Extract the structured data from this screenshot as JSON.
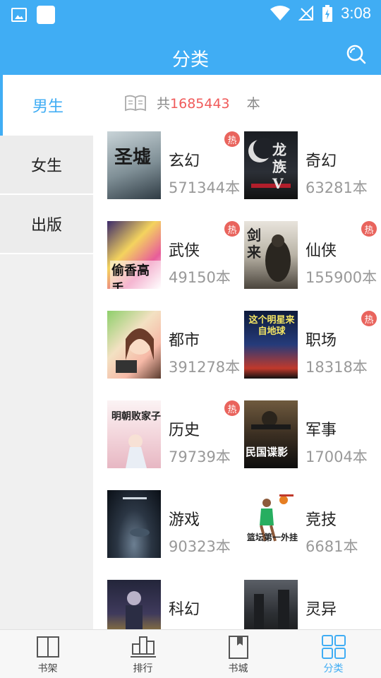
{
  "status_bar": {
    "time": "3:08"
  },
  "header": {
    "title": "分类"
  },
  "sidebar": {
    "items": [
      {
        "label": "男生",
        "active": true
      },
      {
        "label": "女生",
        "active": false
      },
      {
        "label": "出版",
        "active": false
      }
    ]
  },
  "summary": {
    "prefix": "共",
    "count": "1685443",
    "suffix": "本"
  },
  "categories": [
    {
      "name": "玄幻",
      "count": "571344本",
      "hot": "热",
      "cover_text": "圣墟"
    },
    {
      "name": "奇幻",
      "count": "63281本",
      "hot": "",
      "cover_text": "龙族V"
    },
    {
      "name": "武侠",
      "count": "49150本",
      "hot": "热",
      "cover_text": "偷香高手"
    },
    {
      "name": "仙侠",
      "count": "155900本",
      "hot": "热",
      "cover_text": "剑来"
    },
    {
      "name": "都市",
      "count": "391278本",
      "hot": "",
      "cover_text": ""
    },
    {
      "name": "职场",
      "count": "18318本",
      "hot": "热",
      "cover_text": "这个明星来自地球"
    },
    {
      "name": "历史",
      "count": "79739本",
      "hot": "热",
      "cover_text": "明朝败家子"
    },
    {
      "name": "军事",
      "count": "17004本",
      "hot": "",
      "cover_text": "民国谍影"
    },
    {
      "name": "游戏",
      "count": "90323本",
      "hot": "",
      "cover_text": ""
    },
    {
      "name": "竞技",
      "count": "6681本",
      "hot": "",
      "cover_text": "篮坛第一外挂"
    },
    {
      "name": "科幻",
      "count": "",
      "hot": "",
      "cover_text": ""
    },
    {
      "name": "灵异",
      "count": "",
      "hot": "",
      "cover_text": ""
    }
  ],
  "bottom_nav": {
    "items": [
      {
        "label": "书架",
        "icon": "bookshelf-icon",
        "active": false
      },
      {
        "label": "排行",
        "icon": "ranking-icon",
        "active": false
      },
      {
        "label": "书城",
        "icon": "bookstore-icon",
        "active": false
      },
      {
        "label": "分类",
        "icon": "category-icon",
        "active": true
      }
    ]
  },
  "colors": {
    "primary": "#40adf4",
    "hot_badge": "#e9645d",
    "count_highlight": "#f05a5a"
  }
}
